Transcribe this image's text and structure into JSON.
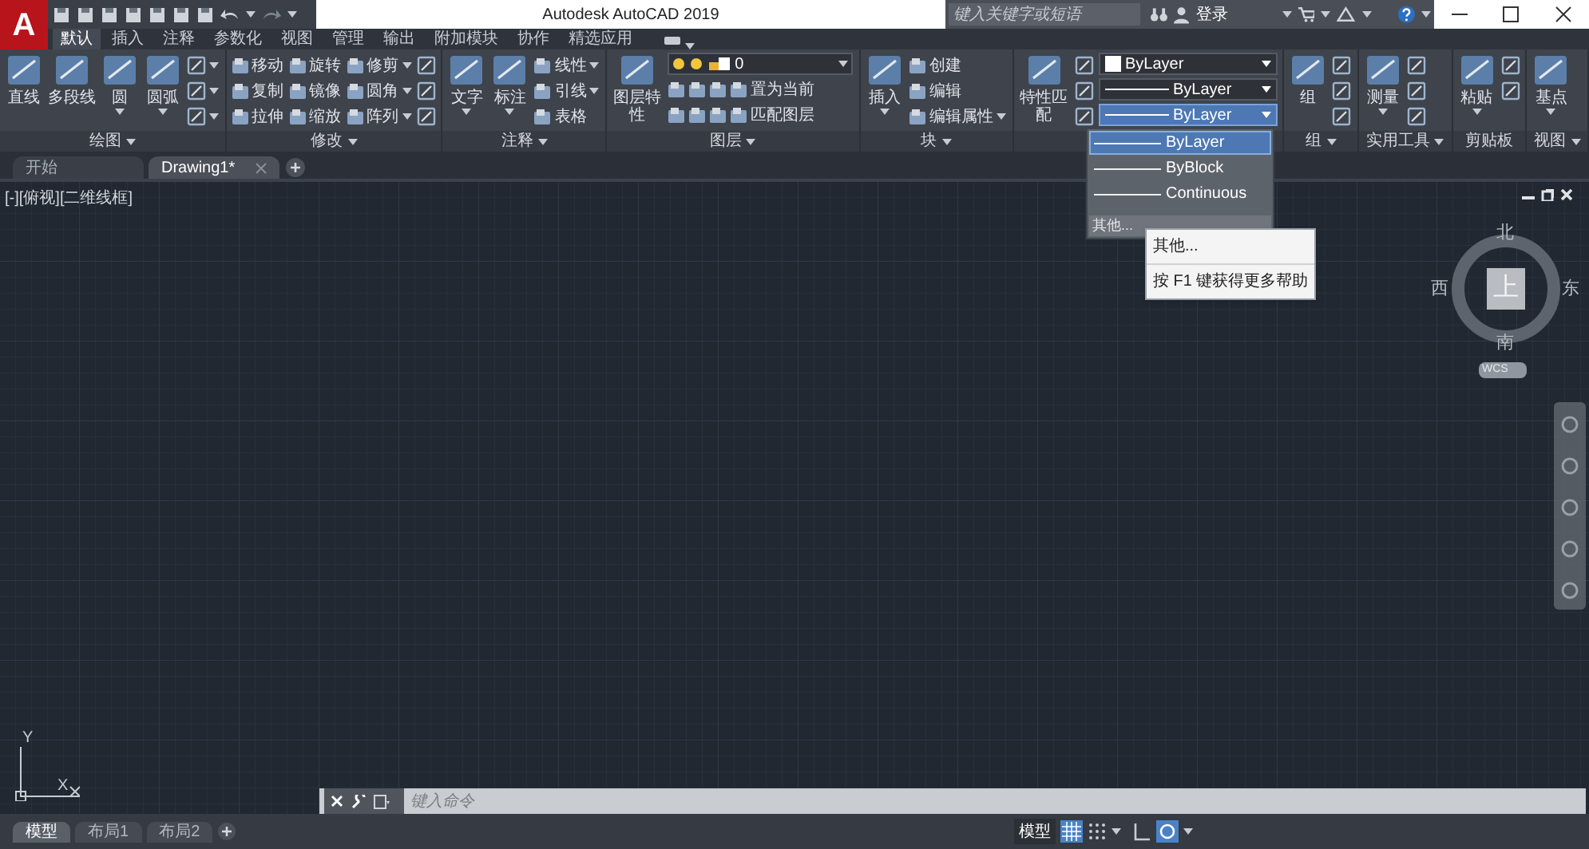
{
  "title_bar": {
    "app_button": "A",
    "title": "Autodesk AutoCAD 2019",
    "search": {
      "placeholder": "键入关键字或短语"
    },
    "sign_in": "登录"
  },
  "ribbon_tabs": [
    {
      "label": "默认",
      "selected": true
    },
    {
      "label": "插入",
      "selected": false
    },
    {
      "label": "注释",
      "selected": false
    },
    {
      "label": "参数化",
      "selected": false
    },
    {
      "label": "视图",
      "selected": false
    },
    {
      "label": "管理",
      "selected": false
    },
    {
      "label": "输出",
      "selected": false
    },
    {
      "label": "附加模块",
      "selected": false
    },
    {
      "label": "协作",
      "selected": false
    },
    {
      "label": "精选应用",
      "selected": false
    }
  ],
  "panels": [
    {
      "title": "绘图",
      "menu": true,
      "columns": [
        [
          {
            "kind": "large",
            "label": "直线",
            "menu": false
          }
        ],
        [
          {
            "kind": "large",
            "label": "多段线",
            "menu": false
          }
        ],
        [
          {
            "kind": "large",
            "label": "圆",
            "menu": true
          }
        ],
        [
          {
            "kind": "large",
            "label": "圆弧",
            "menu": true
          }
        ],
        [
          {
            "kind": "icon",
            "menu": true
          },
          {
            "kind": "icon",
            "menu": true
          },
          {
            "kind": "icon",
            "menu": true
          }
        ]
      ]
    },
    {
      "title": "修改",
      "menu": true,
      "columns": [
        [
          {
            "kind": "small",
            "label": "移动",
            "menu": false
          },
          {
            "kind": "small",
            "label": "复制",
            "menu": false
          },
          {
            "kind": "small",
            "label": "拉伸",
            "menu": false
          }
        ],
        [
          {
            "kind": "small",
            "label": "旋转",
            "menu": false
          },
          {
            "kind": "small",
            "label": "镜像",
            "menu": false
          },
          {
            "kind": "small",
            "label": "缩放",
            "menu": false
          }
        ],
        [
          {
            "kind": "small",
            "label": "修剪",
            "menu": true
          },
          {
            "kind": "small",
            "label": "圆角",
            "menu": true
          },
          {
            "kind": "small",
            "label": "阵列",
            "menu": true
          }
        ],
        [
          {
            "kind": "icon"
          },
          {
            "kind": "icon"
          },
          {
            "kind": "icon"
          }
        ]
      ]
    },
    {
      "title": "注释",
      "menu": true,
      "columns": [
        [
          {
            "kind": "large",
            "label": "文字",
            "menu": true
          }
        ],
        [
          {
            "kind": "large",
            "label": "标注",
            "menu": true
          }
        ],
        [
          {
            "kind": "small",
            "label": "线性",
            "menu": true
          },
          {
            "kind": "small",
            "label": "引线",
            "menu": true
          },
          {
            "kind": "small",
            "label": "表格",
            "menu": false
          }
        ]
      ]
    },
    {
      "title": "图层",
      "menu": true,
      "columns": [
        [
          {
            "kind": "large",
            "label": "图层特性",
            "menu": false
          }
        ],
        [
          {
            "kind": "layer_combo",
            "value": "0"
          },
          {
            "kind": "icon_row",
            "label": "置为当前",
            "menu": false
          },
          {
            "kind": "icon_row",
            "label": "匹配图层",
            "menu": false
          }
        ]
      ]
    },
    {
      "title": "块",
      "menu": true,
      "columns": [
        [
          {
            "kind": "large",
            "label": "插入",
            "menu": true
          }
        ],
        [
          {
            "kind": "small",
            "label": "创建",
            "menu": false
          },
          {
            "kind": "small",
            "label": "编辑",
            "menu": false
          },
          {
            "kind": "small",
            "label": "编辑属性",
            "menu": true
          }
        ]
      ]
    },
    {
      "columns": [
        [
          {
            "kind": "large",
            "label": "特性匹配",
            "menu": false
          }
        ],
        [
          {
            "kind": "icon"
          },
          {
            "kind": "icon"
          },
          {
            "kind": "icon"
          }
        ],
        [
          {
            "kind": "color_combo",
            "value": "ByLayer",
            "selected": false
          },
          {
            "kind": "line_combo",
            "value": "ByLayer",
            "selected": false
          },
          {
            "kind": "line_combo",
            "value": "ByLayer",
            "selected": true
          }
        ]
      ]
    },
    {
      "title": "组",
      "menu": true,
      "columns": [
        [
          {
            "kind": "large",
            "label": "组",
            "menu": false
          }
        ],
        [
          {
            "kind": "icon"
          },
          {
            "kind": "icon"
          },
          {
            "kind": "icon"
          }
        ]
      ]
    },
    {
      "title": "实用工具",
      "menu": true,
      "columns": [
        [
          {
            "kind": "large",
            "label": "测量",
            "menu": true
          }
        ],
        [
          {
            "kind": "icon"
          },
          {
            "kind": "icon"
          },
          {
            "kind": "icon"
          }
        ]
      ]
    },
    {
      "title": "剪贴板",
      "menu": false,
      "columns": [
        [
          {
            "kind": "large",
            "label": "粘贴",
            "menu": true
          }
        ],
        [
          {
            "kind": "icon"
          },
          {
            "kind": "icon"
          }
        ]
      ]
    },
    {
      "title": "视图",
      "menu": true,
      "columns": [
        [
          {
            "kind": "large",
            "label": "基点",
            "menu": true
          }
        ]
      ]
    }
  ],
  "linetype_dropdown": {
    "items": [
      {
        "label": "ByLayer",
        "selected": true
      },
      {
        "label": "ByBlock",
        "selected": false
      },
      {
        "label": "Continuous",
        "selected": false
      }
    ],
    "footer": "其他...",
    "tooltip": {
      "title": "其他...",
      "help": "按 F1 键获得更多帮助"
    }
  },
  "document_tabs": [
    {
      "label": "开始",
      "selected": false
    },
    {
      "label": "Drawing1*",
      "selected": true
    }
  ],
  "viewport": {
    "label": "[-][俯视][二维线框]",
    "viewcube": {
      "north": "北",
      "south": "南",
      "east": "东",
      "west": "西",
      "face": "上",
      "wcs": "WCS"
    },
    "ucs": {
      "y": "Y",
      "x": "X"
    },
    "command_line": {
      "placeholder": "键入命令"
    }
  },
  "layout_tabs": [
    {
      "label": "模型",
      "selected": true
    },
    {
      "label": "布局1",
      "selected": false
    },
    {
      "label": "布局2",
      "selected": false
    }
  ],
  "status_bar": {
    "space": "模型"
  }
}
